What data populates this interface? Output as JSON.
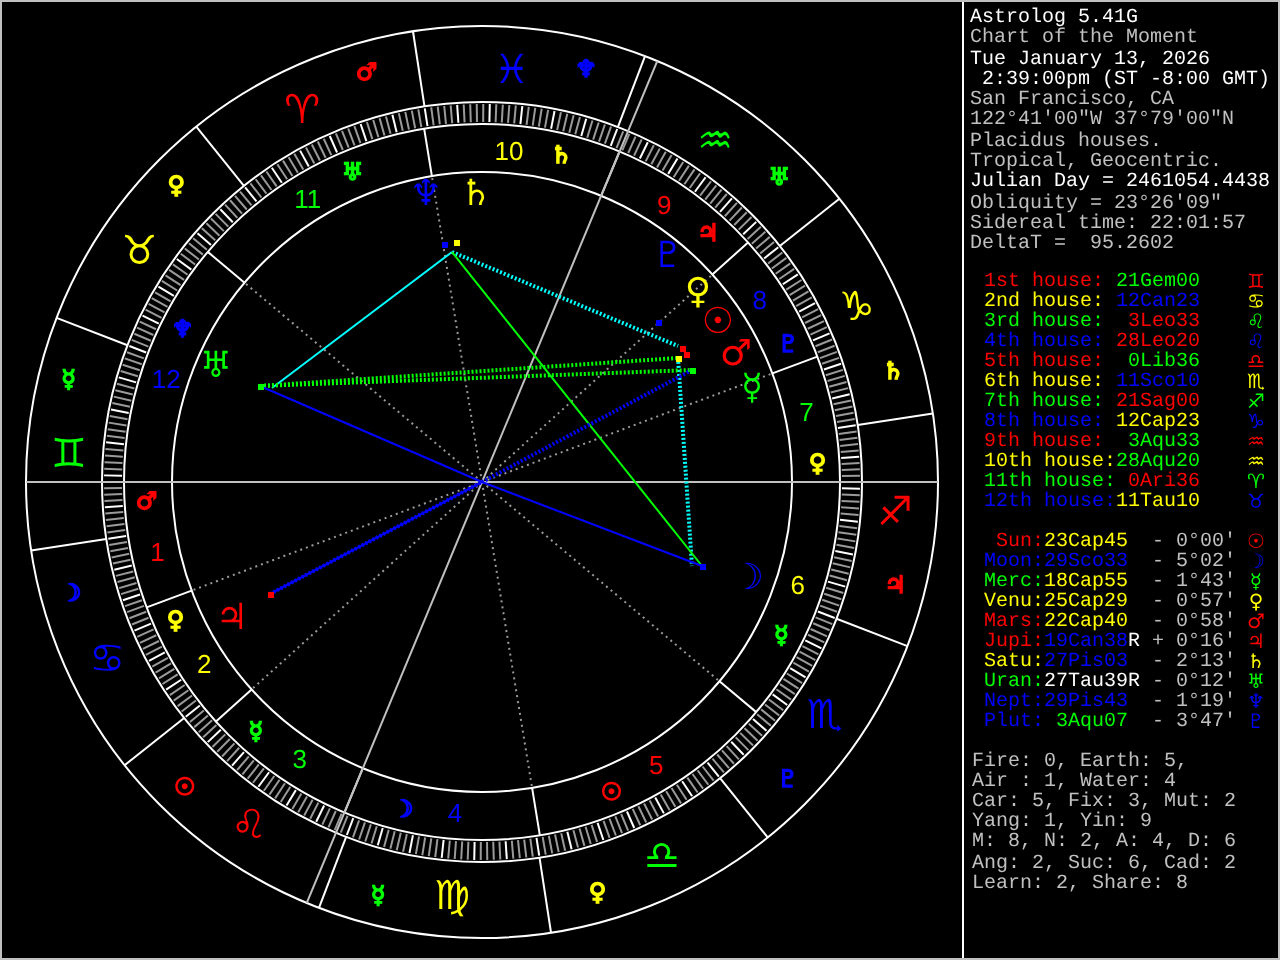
{
  "wheel": {
    "houses": [
      {
        "number": "1",
        "color": "#ff0000",
        "ruler": {
          "glyph": "♂",
          "color": "#ff0000"
        }
      },
      {
        "number": "2",
        "color": "#ffff00",
        "ruler": {
          "glyph": "♀",
          "color": "#ffff00"
        }
      },
      {
        "number": "3",
        "color": "#00ff00",
        "ruler": {
          "glyph": "☿",
          "color": "#00ff00"
        }
      },
      {
        "number": "4",
        "color": "#0000ff",
        "ruler": {
          "glyph": "☽",
          "color": "#0000ff"
        }
      },
      {
        "number": "5",
        "color": "#ff0000",
        "ruler": {
          "glyph": "☉",
          "color": "#ff0000"
        }
      },
      {
        "number": "6",
        "color": "#ffff00",
        "ruler": {
          "glyph": "☿",
          "color": "#00ff00"
        }
      },
      {
        "number": "7",
        "color": "#00ff00",
        "ruler": {
          "glyph": "♀",
          "color": "#ffff00"
        }
      },
      {
        "number": "8",
        "color": "#0000ff",
        "ruler": {
          "glyph": "♇",
          "color": "#0000ff"
        }
      },
      {
        "number": "9",
        "color": "#ff0000",
        "ruler": {
          "glyph": "♃",
          "color": "#ff0000"
        }
      },
      {
        "number": "10",
        "color": "#ffff00",
        "ruler": {
          "glyph": "♄",
          "color": "#ffff00"
        }
      },
      {
        "number": "11",
        "color": "#00ff00",
        "ruler": {
          "glyph": "♅",
          "color": "#00ff00"
        }
      },
      {
        "number": "12",
        "color": "#0000ff",
        "ruler": {
          "glyph": "♆",
          "color": "#0000ff"
        }
      }
    ],
    "signs": [
      {
        "glyph": "♈",
        "color": "#ff0000",
        "ruler": {
          "glyph": "♂",
          "color": "#ff0000"
        }
      },
      {
        "glyph": "♉",
        "color": "#ffff00",
        "ruler": {
          "glyph": "♀",
          "color": "#ffff00"
        }
      },
      {
        "glyph": "♊",
        "color": "#00ff00",
        "ruler": {
          "glyph": "☿",
          "color": "#00ff00"
        }
      },
      {
        "glyph": "♋",
        "color": "#0000ff",
        "ruler": {
          "glyph": "☽",
          "color": "#0000ff"
        }
      },
      {
        "glyph": "♌",
        "color": "#ff0000",
        "ruler": {
          "glyph": "☉",
          "color": "#ff0000"
        }
      },
      {
        "glyph": "♍",
        "color": "#ffff00",
        "ruler": {
          "glyph": "☿",
          "color": "#00ff00"
        }
      },
      {
        "glyph": "♎",
        "color": "#00ff00",
        "ruler": {
          "glyph": "♀",
          "color": "#ffff00"
        }
      },
      {
        "glyph": "♏",
        "color": "#0000ff",
        "ruler": {
          "glyph": "♇",
          "color": "#0000ff"
        }
      },
      {
        "glyph": "♐",
        "color": "#ff0000",
        "ruler": {
          "glyph": "♃",
          "color": "#ff0000"
        }
      },
      {
        "glyph": "♑",
        "color": "#ffff00",
        "ruler": {
          "glyph": "♄",
          "color": "#ffff00"
        }
      },
      {
        "glyph": "♒",
        "color": "#00ff00",
        "ruler": {
          "glyph": "♅",
          "color": "#00ff00"
        }
      },
      {
        "glyph": "♓",
        "color": "#0000ff",
        "ruler": {
          "glyph": "♆",
          "color": "#0000ff"
        }
      }
    ],
    "planets": [
      {
        "glyph": "♆",
        "color": "#0000ff"
      },
      {
        "glyph": "♄",
        "color": "#ffff00"
      },
      {
        "glyph": "♇",
        "color": "#0000ff"
      },
      {
        "glyph": "♀",
        "color": "#ffff00"
      },
      {
        "glyph": "☉",
        "color": "#ff0000"
      },
      {
        "glyph": "♂",
        "color": "#ff0000"
      },
      {
        "glyph": "♅",
        "color": "#00ff00"
      },
      {
        "glyph": "☿",
        "color": "#00ff00"
      },
      {
        "glyph": "☽",
        "color": "#0000ff"
      },
      {
        "glyph": "♃",
        "color": "#ff0000"
      }
    ]
  },
  "info": {
    "header": [
      {
        "text": "Astrolog 5.41G",
        "highlight": true
      },
      {
        "text": "Chart of the Moment",
        "highlight": false
      },
      {
        "text": "Tue January 13, 2026",
        "highlight": true
      },
      {
        "text": " 2:39:00pm (ST -8:00 GMT)",
        "highlight": true
      },
      {
        "text": "San Francisco, CA",
        "highlight": false
      },
      {
        "text": "122°41'00\"W 37°79'00\"N",
        "highlight": false
      },
      {
        "text": "Placidus houses.",
        "highlight": false
      },
      {
        "text": "Tropical, Geocentric.",
        "highlight": false
      },
      {
        "text": "Julian Day = 2461054.4438",
        "highlight": true
      },
      {
        "text": "Obliquity = 23°26'09\"",
        "highlight": false
      },
      {
        "text": "Sidereal time: 22:01:57",
        "highlight": false
      },
      {
        "text": "DeltaT =  95.2602",
        "highlight": false
      }
    ],
    "houses": [
      {
        "label": "1st house:",
        "color": "#ff0000",
        "position": {
          "text": "21Gem00",
          "color": "#00ff00"
        },
        "glyph": "♊"
      },
      {
        "label": "2nd house:",
        "color": "#ffff00",
        "position": {
          "text": "12Can23",
          "color": "#0000ff"
        },
        "glyph": "♋"
      },
      {
        "label": "3rd house:",
        "color": "#00ff00",
        "position": {
          "text": "3Leo33",
          "color": "#ff0000"
        },
        "glyph": "♌"
      },
      {
        "label": "4th house:",
        "color": "#0000ff",
        "position": {
          "text": "28Leo20",
          "color": "#ff0000"
        },
        "glyph": "♌"
      },
      {
        "label": "5th house:",
        "color": "#ff0000",
        "position": {
          "text": "0Lib36",
          "color": "#00ff00"
        },
        "glyph": "♎"
      },
      {
        "label": "6th house:",
        "color": "#ffff00",
        "position": {
          "text": "11Sco10",
          "color": "#0000ff"
        },
        "glyph": "♏"
      },
      {
        "label": "7th house:",
        "color": "#00ff00",
        "position": {
          "text": "21Sag00",
          "color": "#ff0000"
        },
        "glyph": "♐"
      },
      {
        "label": "8th house:",
        "color": "#0000ff",
        "position": {
          "text": "12Cap23",
          "color": "#ffff00"
        },
        "glyph": "♑"
      },
      {
        "label": "9th house:",
        "color": "#ff0000",
        "position": {
          "text": "3Aqu33",
          "color": "#00ff00"
        },
        "glyph": "♒"
      },
      {
        "label": "10th house:",
        "color": "#ffff00",
        "position": {
          "text": "28Aqu20",
          "color": "#00ff00"
        },
        "glyph": "♒"
      },
      {
        "label": "11th house:",
        "color": "#00ff00",
        "position": {
          "text": "0Ari36",
          "color": "#ff0000"
        },
        "glyph": "♈"
      },
      {
        "label": "12th house:",
        "color": "#0000ff",
        "position": {
          "text": "11Tau10",
          "color": "#ffff00"
        },
        "glyph": "♉"
      }
    ],
    "planets": [
      {
        "name": "Sun:",
        "color": "#ff0000",
        "position": {
          "text": "23Cap45",
          "color": "#ffff00"
        },
        "aspect": "- 0°00'",
        "glyph": "☉"
      },
      {
        "name": "Moon:",
        "color": "#0000ff",
        "position": {
          "text": "29Sco33",
          "color": "#0000ff"
        },
        "aspect": "- 5°02'",
        "glyph": "☽"
      },
      {
        "name": "Merc:",
        "color": "#00ff00",
        "position": {
          "text": "18Cap55",
          "color": "#ffff00"
        },
        "aspect": "- 1°43'",
        "glyph": "☿"
      },
      {
        "name": "Venu:",
        "color": "#ffff00",
        "position": {
          "text": "25Cap29",
          "color": "#ffff00"
        },
        "aspect": "- 0°57'",
        "glyph": "♀"
      },
      {
        "name": "Mars:",
        "color": "#ff0000",
        "position": {
          "text": "22Cap40",
          "color": "#ffff00"
        },
        "aspect": "- 0°58'",
        "glyph": "♂"
      },
      {
        "name": "Jupi:",
        "color": "#ff0000",
        "position": {
          "text": "19Can38",
          "color": "#0000ff"
        },
        "retrograde": "R",
        "aspect": "+ 0°16'",
        "glyph": "♃"
      },
      {
        "name": "Satu:",
        "color": "#ffff00",
        "position": {
          "text": "27Pis03",
          "color": "#0000ff"
        },
        "aspect": "- 2°13'",
        "glyph": "♄"
      },
      {
        "name": "Uran:",
        "color": "#00ff00",
        "position": {
          "text": "27Tau39",
          "color": "#ffffff"
        },
        "retrograde": "R",
        "aspect": "- 0°12'",
        "glyph": "♅"
      },
      {
        "name": "Nept:",
        "color": "#0000ff",
        "position": {
          "text": "29Pis43",
          "color": "#0000ff"
        },
        "aspect": "- 1°19'",
        "glyph": "♆"
      },
      {
        "name": "Plut:",
        "color": "#0000ff",
        "position": {
          "text": "3Aqu07",
          "color": "#00ff00"
        },
        "aspect": "- 3°47'",
        "glyph": "♇"
      }
    ],
    "summary": [
      "Fire: 0, Earth: 5,",
      "Air : 1, Water: 4",
      "Car: 5, Fix: 3, Mut: 2",
      "Yang: 1, Yin: 9",
      "M: 8, N: 2, A: 4, D: 6",
      "Ang: 2, Suc: 6, Cad: 2",
      "Learn: 2, Share: 8"
    ]
  }
}
